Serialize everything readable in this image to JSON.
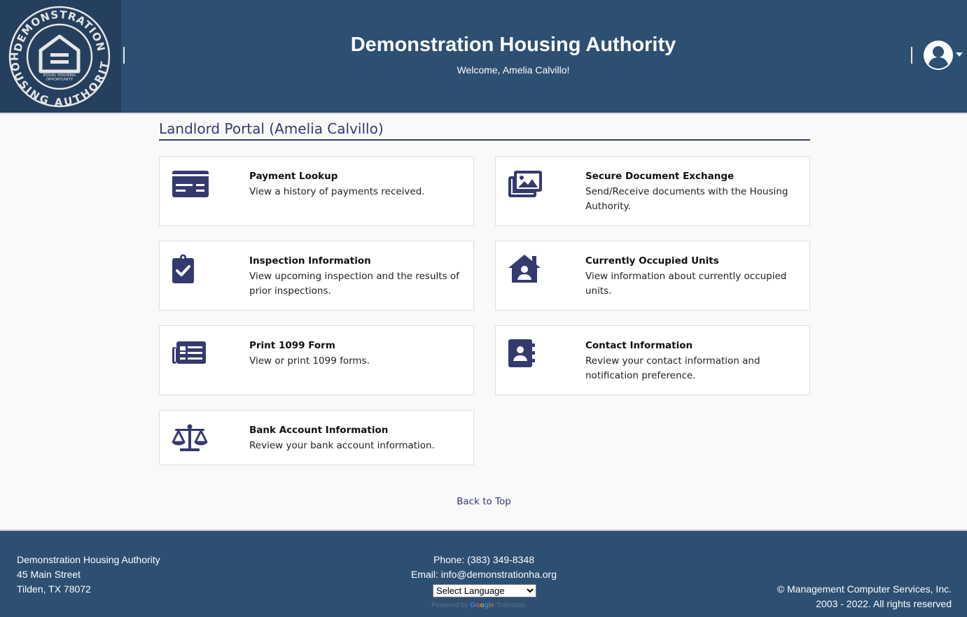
{
  "header": {
    "title": "Demonstration Housing Authority",
    "welcome": "Welcome, Amelia Calvillo!",
    "logo": {
      "ring_text_top": "DEMONSTRATION",
      "ring_text_bottom": "HOUSING AUTHORITY",
      "inner_text_1": "EQUAL HOUSING",
      "inner_text_2": "OPPORTUNITY"
    }
  },
  "page": {
    "portal_title": "Landlord Portal (Amelia Calvillo)",
    "back_to_top": "Back to Top"
  },
  "cards": [
    {
      "title": "Payment Lookup",
      "desc": "View a history of payments received.",
      "icon": "credit-card-icon"
    },
    {
      "title": "Secure Document Exchange",
      "desc": "Send/Receive documents with the Housing Authority.",
      "icon": "images-icon"
    },
    {
      "title": "Inspection Information",
      "desc": "View upcoming inspection and the results of prior inspections.",
      "icon": "clipboard-check-icon"
    },
    {
      "title": "Currently Occupied Units",
      "desc": "View information about currently occupied units.",
      "icon": "house-user-icon"
    },
    {
      "title": "Print 1099 Form",
      "desc": "View or print 1099 forms.",
      "icon": "newspaper-icon"
    },
    {
      "title": "Contact Information",
      "desc": "Review your contact information and notification preference.",
      "icon": "address-book-icon"
    },
    {
      "title": "Bank Account Information",
      "desc": "Review your bank account information.",
      "icon": "balance-scale-icon"
    }
  ],
  "footer": {
    "org_name": "Demonstration Housing Authority",
    "street": "45 Main Street",
    "city": "Tilden, TX 78072",
    "phone": "Phone: (383) 349-8348",
    "email": "Email: info@demonstrationha.org",
    "language_select": "Select Language",
    "powered_prefix": "Powered by ",
    "powered_suffix": " Translate",
    "copyright": "© Management Computer Services, Inc.",
    "rights": "2003 - 2022. All rights reserved"
  },
  "colors": {
    "header_bg": "#2d4f72",
    "logo_bg": "#253f5e",
    "accent": "#353a6e",
    "page_bg": "#f9f9f9"
  }
}
